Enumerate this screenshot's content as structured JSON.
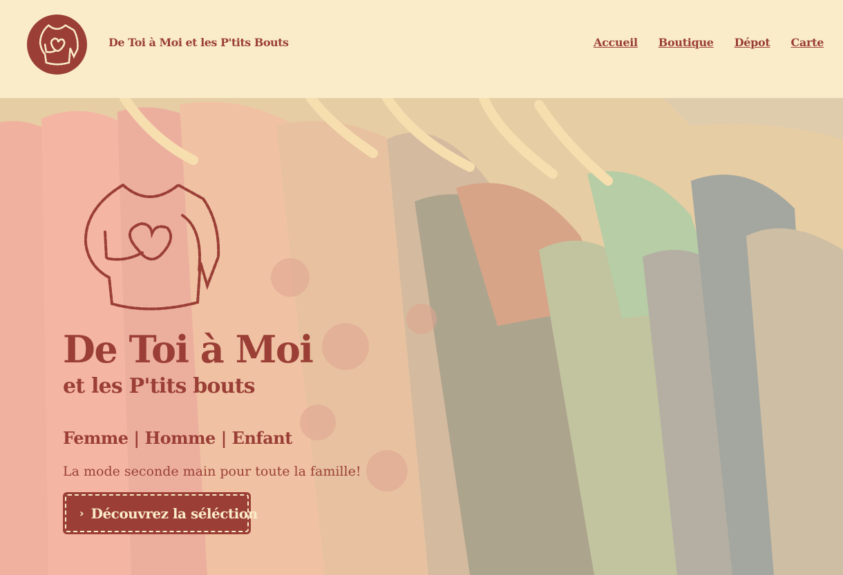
{
  "header": {
    "site_title": "De Toi à Moi et les P'tits Bouts",
    "nav": [
      {
        "label": "Accueil"
      },
      {
        "label": "Boutique"
      },
      {
        "label": "Dépot"
      },
      {
        "label": "Carte"
      }
    ]
  },
  "hero": {
    "title": "De Toi à Moi",
    "subtitle": "et les P'tits bouts",
    "categories": "Femme | Homme | Enfant",
    "tagline": "La mode seconde main pour toute la famille!",
    "cta_label": "Découvrez la séléction",
    "cta_icon": "chevron-right-icon"
  },
  "colors": {
    "brand": "#9b3f36",
    "background": "#faecc9"
  }
}
